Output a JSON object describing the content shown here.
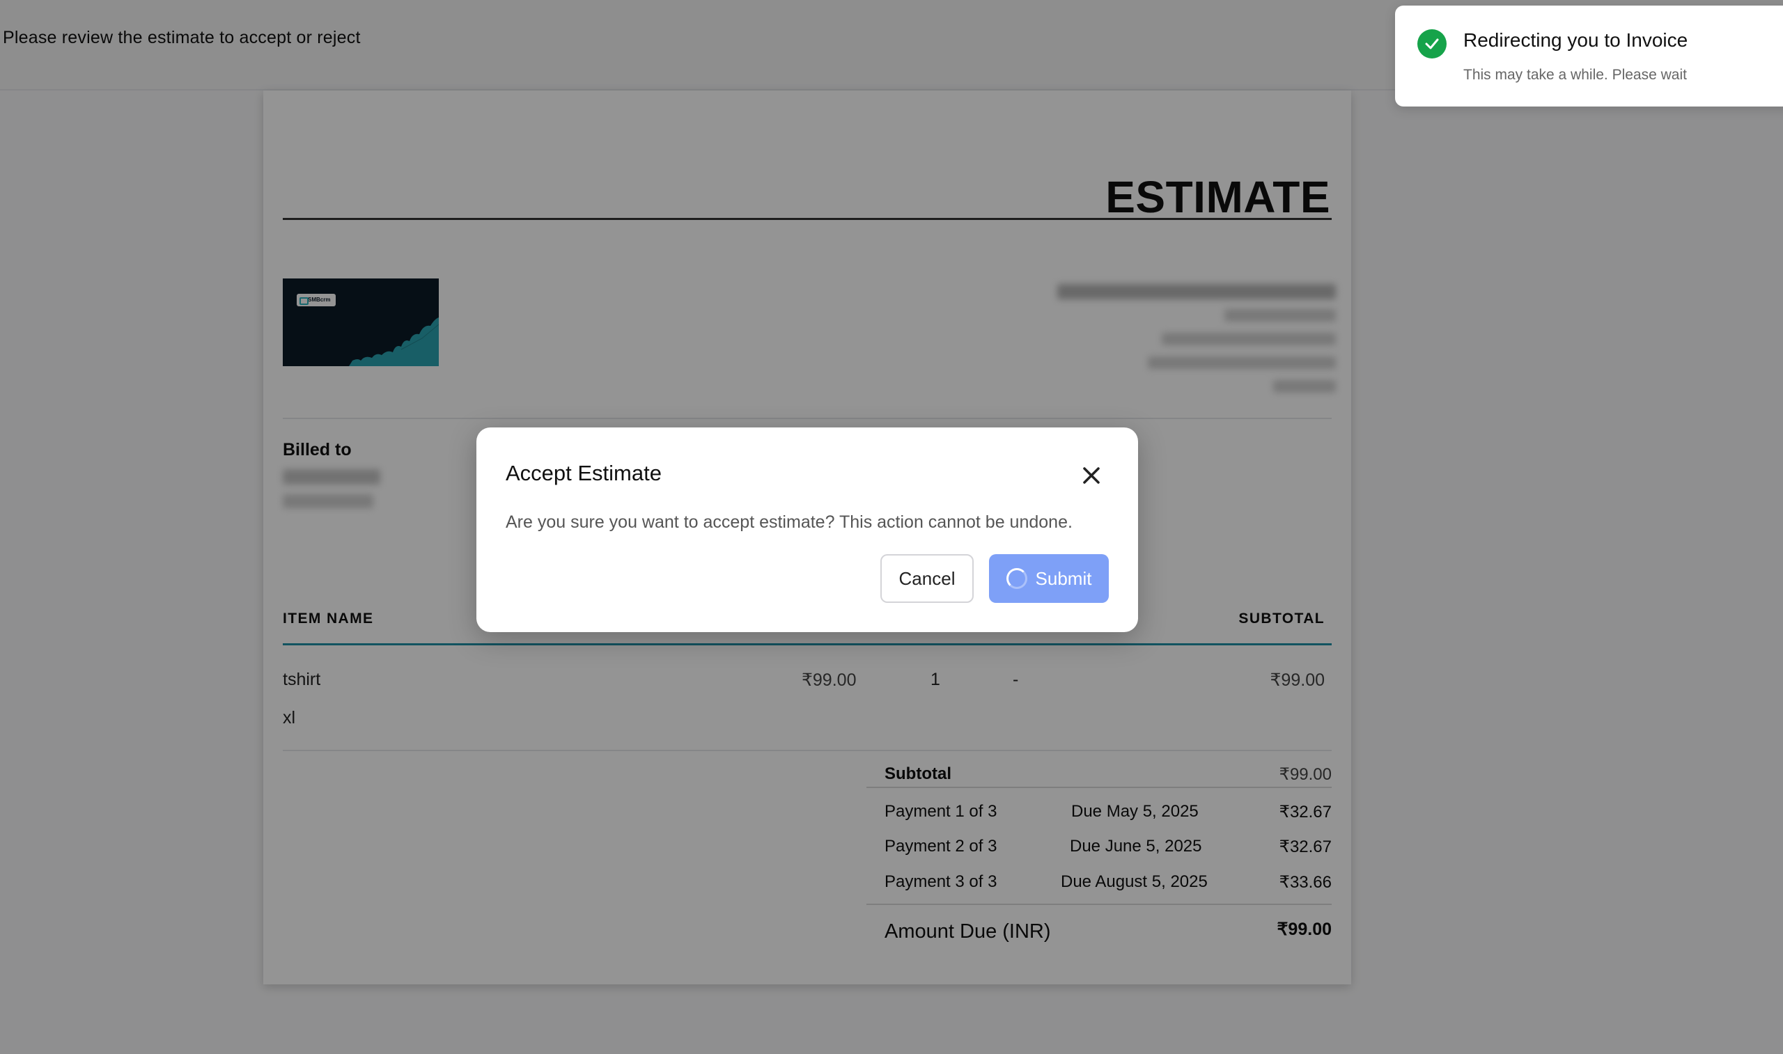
{
  "header": {
    "instruction": "Please review the estimate to accept or reject"
  },
  "document": {
    "title": "ESTIMATE",
    "logo_text": "SMBcrm",
    "billed_to_label": "Billed to",
    "columns": {
      "item": "ITEM NAME",
      "subtotal": "SUBTOTAL"
    },
    "items": [
      {
        "name": "tshirt",
        "variant": "xl",
        "price": "₹99.00",
        "qty": "1",
        "discount": "-",
        "subtotal": "₹99.00"
      }
    ],
    "totals": {
      "subtotal_label": "Subtotal",
      "subtotal_value": "₹99.00",
      "payments": [
        {
          "label": "Payment 1 of 3",
          "due": "Due May 5, 2025",
          "amount": "₹32.67"
        },
        {
          "label": "Payment 2 of 3",
          "due": "Due June 5, 2025",
          "amount": "₹32.67"
        },
        {
          "label": "Payment 3 of 3",
          "due": "Due August 5, 2025",
          "amount": "₹33.66"
        }
      ],
      "amount_due_label": "Amount Due (INR)",
      "amount_due_value": "₹99.00"
    }
  },
  "modal": {
    "title": "Accept Estimate",
    "message": "Are you sure you want to accept estimate? This action cannot be undone.",
    "cancel_label": "Cancel",
    "submit_label": "Submit",
    "close_icon": "close-icon",
    "submit_state": "loading"
  },
  "toast": {
    "title": "Redirecting you to Invoice",
    "subtitle": "This may take a while. Please wait",
    "icon": "check-circle-icon",
    "color": "#16a34a"
  },
  "colors": {
    "accent": "#7ea0f7",
    "table_rule": "#1f8fa6",
    "success": "#16a34a"
  }
}
